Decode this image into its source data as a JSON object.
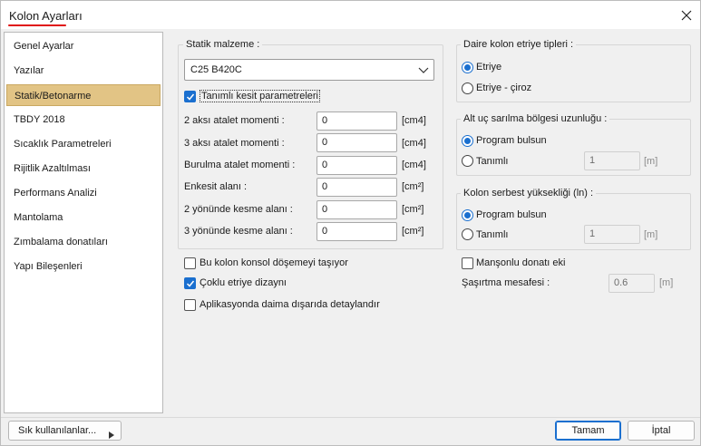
{
  "window": {
    "title": "Kolon Ayarları",
    "close_icon": "close-icon"
  },
  "sidebar": {
    "items": [
      {
        "label": "Genel Ayarlar"
      },
      {
        "label": "Yazılar"
      },
      {
        "label": "Statik/Betonarme"
      },
      {
        "label": "TBDY 2018"
      },
      {
        "label": "Sıcaklık Parametreleri"
      },
      {
        "label": "Rijitlik Azaltılması"
      },
      {
        "label": "Performans Analizi"
      },
      {
        "label": "Mantolama"
      },
      {
        "label": "Zımbalama donatıları"
      },
      {
        "label": "Yapı Bileşenleri"
      }
    ],
    "active_index": 2
  },
  "static_material": {
    "group_label": "Statik malzeme :",
    "selected": "C25 B420C",
    "defined_section_label": "Tanımlı kesit parametreleri",
    "defined_section_checked": true,
    "rows": [
      {
        "label": "2 aksı atalet momenti :",
        "value": "0",
        "unit": "[cm4]"
      },
      {
        "label": "3 aksı atalet momenti :",
        "value": "0",
        "unit": "[cm4]"
      },
      {
        "label": "Burulma atalet momenti :",
        "value": "0",
        "unit": "[cm4]"
      },
      {
        "label": "Enkesit alanı :",
        "value": "0",
        "unit": "[cm²]"
      },
      {
        "label": "2 yönünde kesme alanı :",
        "value": "0",
        "unit": "[cm²]"
      },
      {
        "label": "3 yönünde kesme alanı :",
        "value": "0",
        "unit": "[cm²]"
      }
    ]
  },
  "options": {
    "cantilever_label": "Bu kolon konsol döşemeyi taşıyor",
    "cantilever_checked": false,
    "multi_stirrup_label": "Çoklu etriye dizaynı",
    "multi_stirrup_checked": true,
    "always_outside_label": "Aplikasyonda daima dışarıda detaylandır",
    "always_outside_checked": false
  },
  "stirrup_types": {
    "group_label": "Daire kolon etriye tipleri :",
    "options": [
      "Etriye",
      "Etriye - çiroz"
    ],
    "selected_index": 0
  },
  "confinement_length": {
    "group_label": "Alt uç sarılma bölgesi uzunluğu :",
    "option_program": "Program bulsun",
    "option_defined": "Tanımlı",
    "selected": "program",
    "value": "1",
    "unit": "[m]"
  },
  "free_height": {
    "group_label": "Kolon serbest yüksekliği (ln) :",
    "option_program": "Program bulsun",
    "option_defined": "Tanımlı",
    "selected": "program",
    "value": "1",
    "unit": "[m]"
  },
  "sleeve": {
    "label": "Manşonlu donatı eki",
    "checked": false,
    "offset_label": "Şaşırtma mesafesi :",
    "offset_value": "0.6",
    "offset_unit": "[m]"
  },
  "footer": {
    "favorites_label": "Sık kullanılanlar...",
    "ok_label": "Tamam",
    "cancel_label": "İptal"
  },
  "colors": {
    "accent": "#1a6fcf",
    "active_item": "#e2c485",
    "title_underline": "#e01010"
  }
}
